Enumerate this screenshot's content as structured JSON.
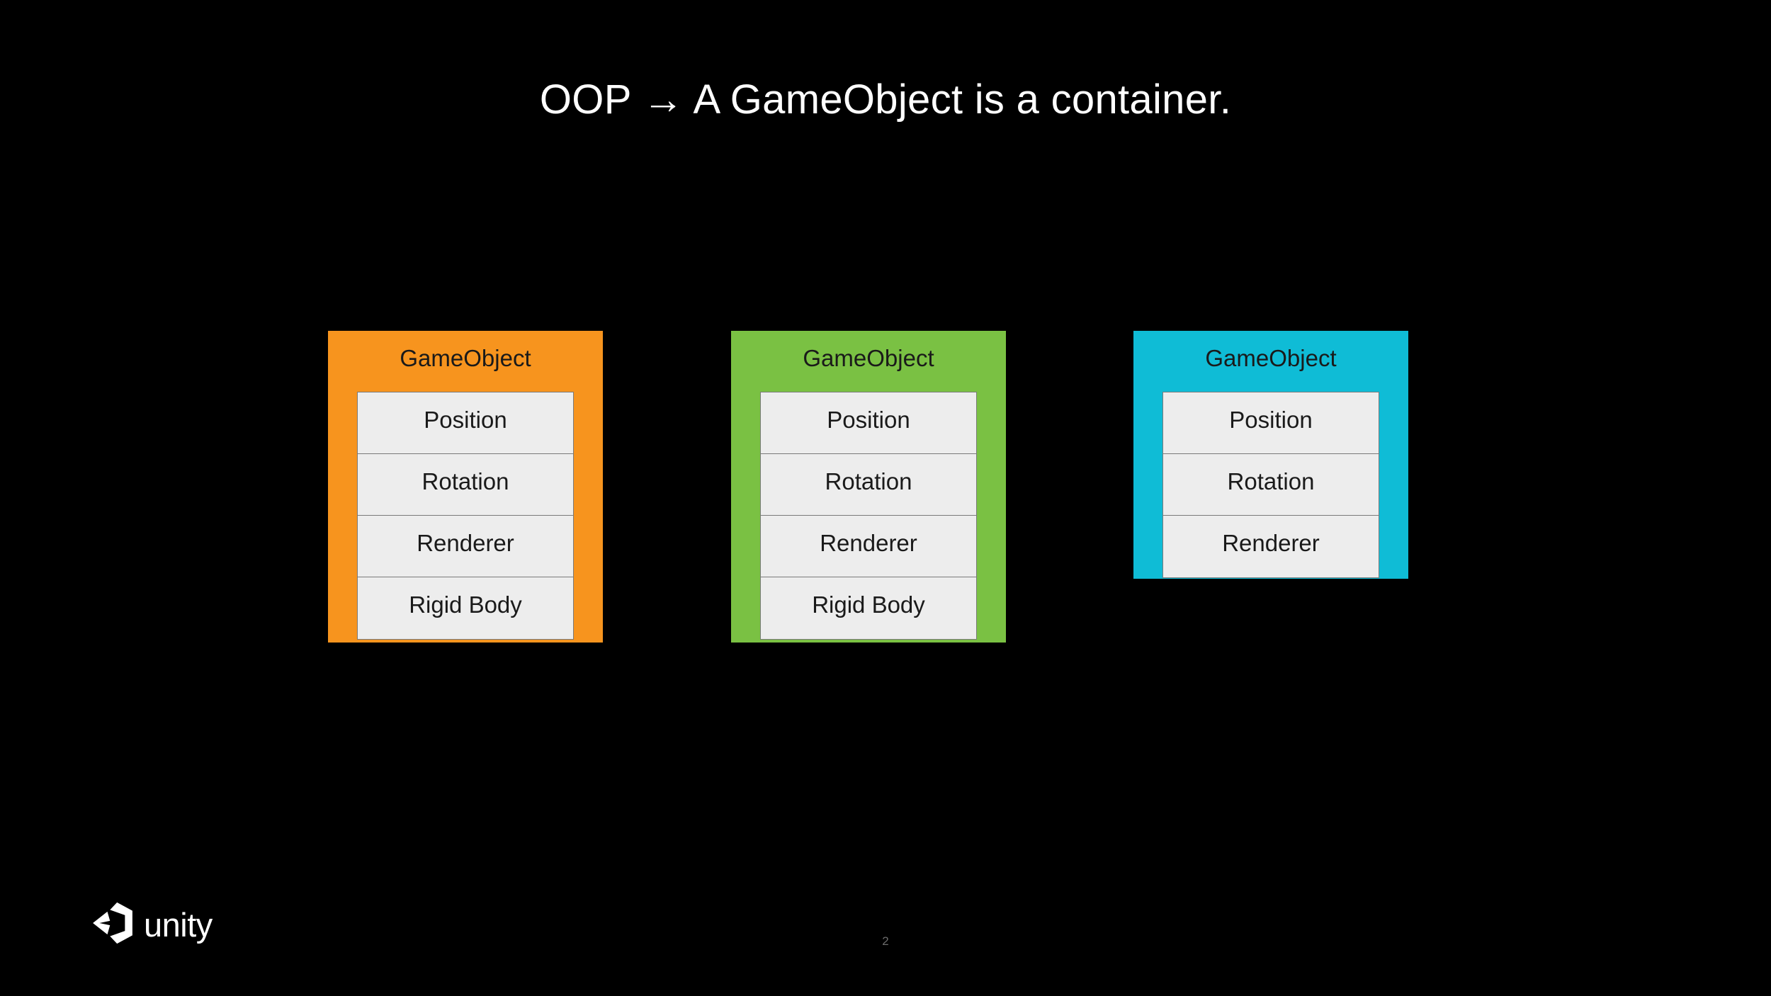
{
  "slide": {
    "background_color": "#000000",
    "title": "OOP → A GameObject is a container.",
    "page_number": "2"
  },
  "cards": [
    {
      "name": "orange-gameobject-card",
      "header": "GameObject",
      "color": "#F7941E",
      "components": [
        "Position",
        "Rotation",
        "Renderer",
        "Rigid Body"
      ]
    },
    {
      "name": "green-gameobject-card",
      "header": "GameObject",
      "color": "#7AC143",
      "components": [
        "Position",
        "Rotation",
        "Renderer",
        "Rigid Body"
      ]
    },
    {
      "name": "cyan-gameobject-card",
      "header": "GameObject",
      "color": "#0FBCD6",
      "components": [
        "Position",
        "Rotation",
        "Renderer"
      ]
    }
  ],
  "footer": {
    "logo_icon": "unity-cube-icon",
    "logo_text": "unity"
  }
}
